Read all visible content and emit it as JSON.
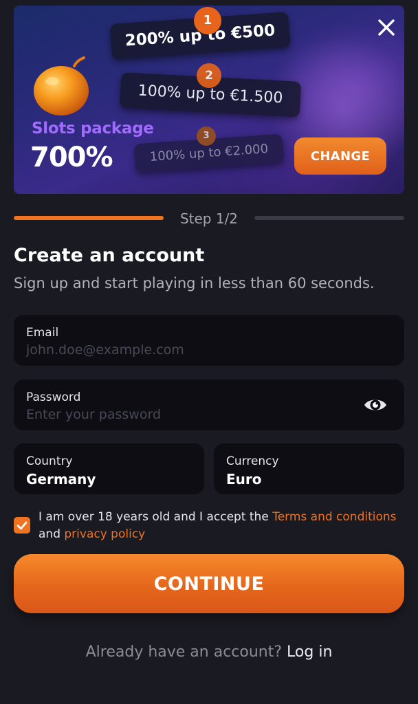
{
  "banner": {
    "package_label": "Slots package",
    "package_percent": "700%",
    "offers": [
      {
        "step": "1",
        "text": "200% up to €500"
      },
      {
        "step": "2",
        "text": "100% up to €1.500"
      },
      {
        "step": "3",
        "text": "100% up to €2.000"
      }
    ],
    "change_label": "CHANGE",
    "icons": {
      "close": "close-icon",
      "fruit": "orange-fruit-icon"
    }
  },
  "progress": {
    "label": "Step 1/2",
    "current": 1,
    "total": 2
  },
  "heading": {
    "title": "Create an account",
    "subtitle": "Sign up and start playing in less than 60 seconds."
  },
  "form": {
    "email": {
      "label": "Email",
      "placeholder": "john.doe@example.com",
      "value": ""
    },
    "password": {
      "label": "Password",
      "placeholder": "Enter your password",
      "value": "",
      "icon": "eye-icon"
    },
    "country": {
      "label": "Country",
      "value": "Germany"
    },
    "currency": {
      "label": "Currency",
      "value": "Euro"
    }
  },
  "consent": {
    "checked": true,
    "text_before": "I am over 18 years old and I accept the ",
    "terms_link": "Terms and conditions",
    "text_middle": " and ",
    "privacy_link": "privacy policy"
  },
  "continue_label": "CONTINUE",
  "login": {
    "prompt": "Already have an account? ",
    "link": "Log in"
  },
  "colors": {
    "accent": "#f0731f",
    "background": "#1a1a22",
    "field_bg": "#0d0d13",
    "purple": "#a26bff"
  }
}
